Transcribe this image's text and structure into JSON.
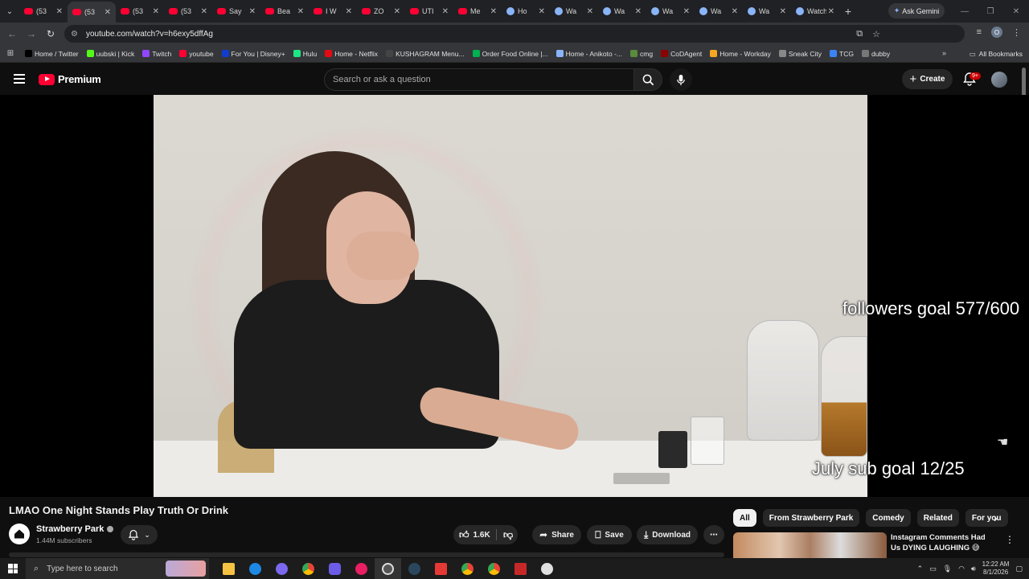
{
  "browser": {
    "tabs": [
      {
        "title": "(53",
        "icon": "youtube-icon"
      },
      {
        "title": "(53",
        "icon": "youtube-icon",
        "active": true
      },
      {
        "title": "(53",
        "icon": "youtube-icon"
      },
      {
        "title": "(53",
        "icon": "youtube-icon"
      },
      {
        "title": "Say",
        "icon": "youtube-icon"
      },
      {
        "title": "Bea",
        "icon": "youtube-icon"
      },
      {
        "title": "I W",
        "icon": "youtube-icon"
      },
      {
        "title": "ZO",
        "icon": "youtube-icon"
      },
      {
        "title": "UTI",
        "icon": "youtube-icon"
      },
      {
        "title": "Me",
        "icon": "youtube-icon"
      },
      {
        "title": "Ho",
        "icon": "globe-icon"
      },
      {
        "title": "Wa",
        "icon": "globe-icon"
      },
      {
        "title": "Wa",
        "icon": "globe-icon"
      },
      {
        "title": "Wa",
        "icon": "globe-icon"
      },
      {
        "title": "Wa",
        "icon": "globe-icon"
      },
      {
        "title": "Wa",
        "icon": "globe-icon"
      },
      {
        "title": "Watch",
        "icon": "globe-icon"
      }
    ],
    "gemini_label": "Ask Gemini",
    "url": "youtube.com/watch?v=h6exy5dffAg",
    "profile_initial": "O",
    "bookmarks": [
      {
        "label": "Home / Twitter",
        "color": "#000000"
      },
      {
        "label": "uubski | Kick",
        "color": "#53fc18"
      },
      {
        "label": "Twitch",
        "color": "#9146ff"
      },
      {
        "label": "youtube",
        "color": "#ff0033"
      },
      {
        "label": "For You | Disney+",
        "color": "#113ccf"
      },
      {
        "label": "Hulu",
        "color": "#1ce783"
      },
      {
        "label": "Home - Netflix",
        "color": "#e50914"
      },
      {
        "label": "KUSHAGRAM Menu...",
        "color": "#444444"
      },
      {
        "label": "Order Food Online |...",
        "color": "#00b14f"
      },
      {
        "label": "Home - Anikoto -...",
        "color": "#8ab4f8"
      },
      {
        "label": "cmg",
        "color": "#5a8a3c"
      },
      {
        "label": "CoDAgent",
        "color": "#8b0000"
      },
      {
        "label": "Home - Workday",
        "color": "#f5a623"
      },
      {
        "label": "Sneak City",
        "color": "#888888"
      },
      {
        "label": "TCG",
        "color": "#3b82f6"
      },
      {
        "label": "dubby",
        "color": "#777777"
      }
    ],
    "all_bookmarks": "All Bookmarks"
  },
  "youtube": {
    "logo_text": "Premium",
    "search_placeholder": "Search or ask a question",
    "create_label": "Create",
    "notif_count": "9+",
    "overlay": {
      "followers_goal": "followers goal 577/600",
      "sub_goal": "July sub goal 12/25"
    },
    "video_title": "LMAO One Night Stands Play Truth Or Drink",
    "channel_name": "Strawberry Park",
    "subscribers": "1.44M subscribers",
    "likes": "1.6K",
    "share_label": "Share",
    "save_label": "Save",
    "download_label": "Download",
    "chips": [
      "All",
      "From Strawberry Park",
      "Comedy",
      "Related",
      "For you"
    ],
    "recommended": {
      "title": "Instagram Comments Had Us DYING LAUGHING 😅"
    }
  },
  "taskbar": {
    "search_placeholder": "Type here to search",
    "time": "12:22 AM",
    "date": "8/1/2026"
  }
}
